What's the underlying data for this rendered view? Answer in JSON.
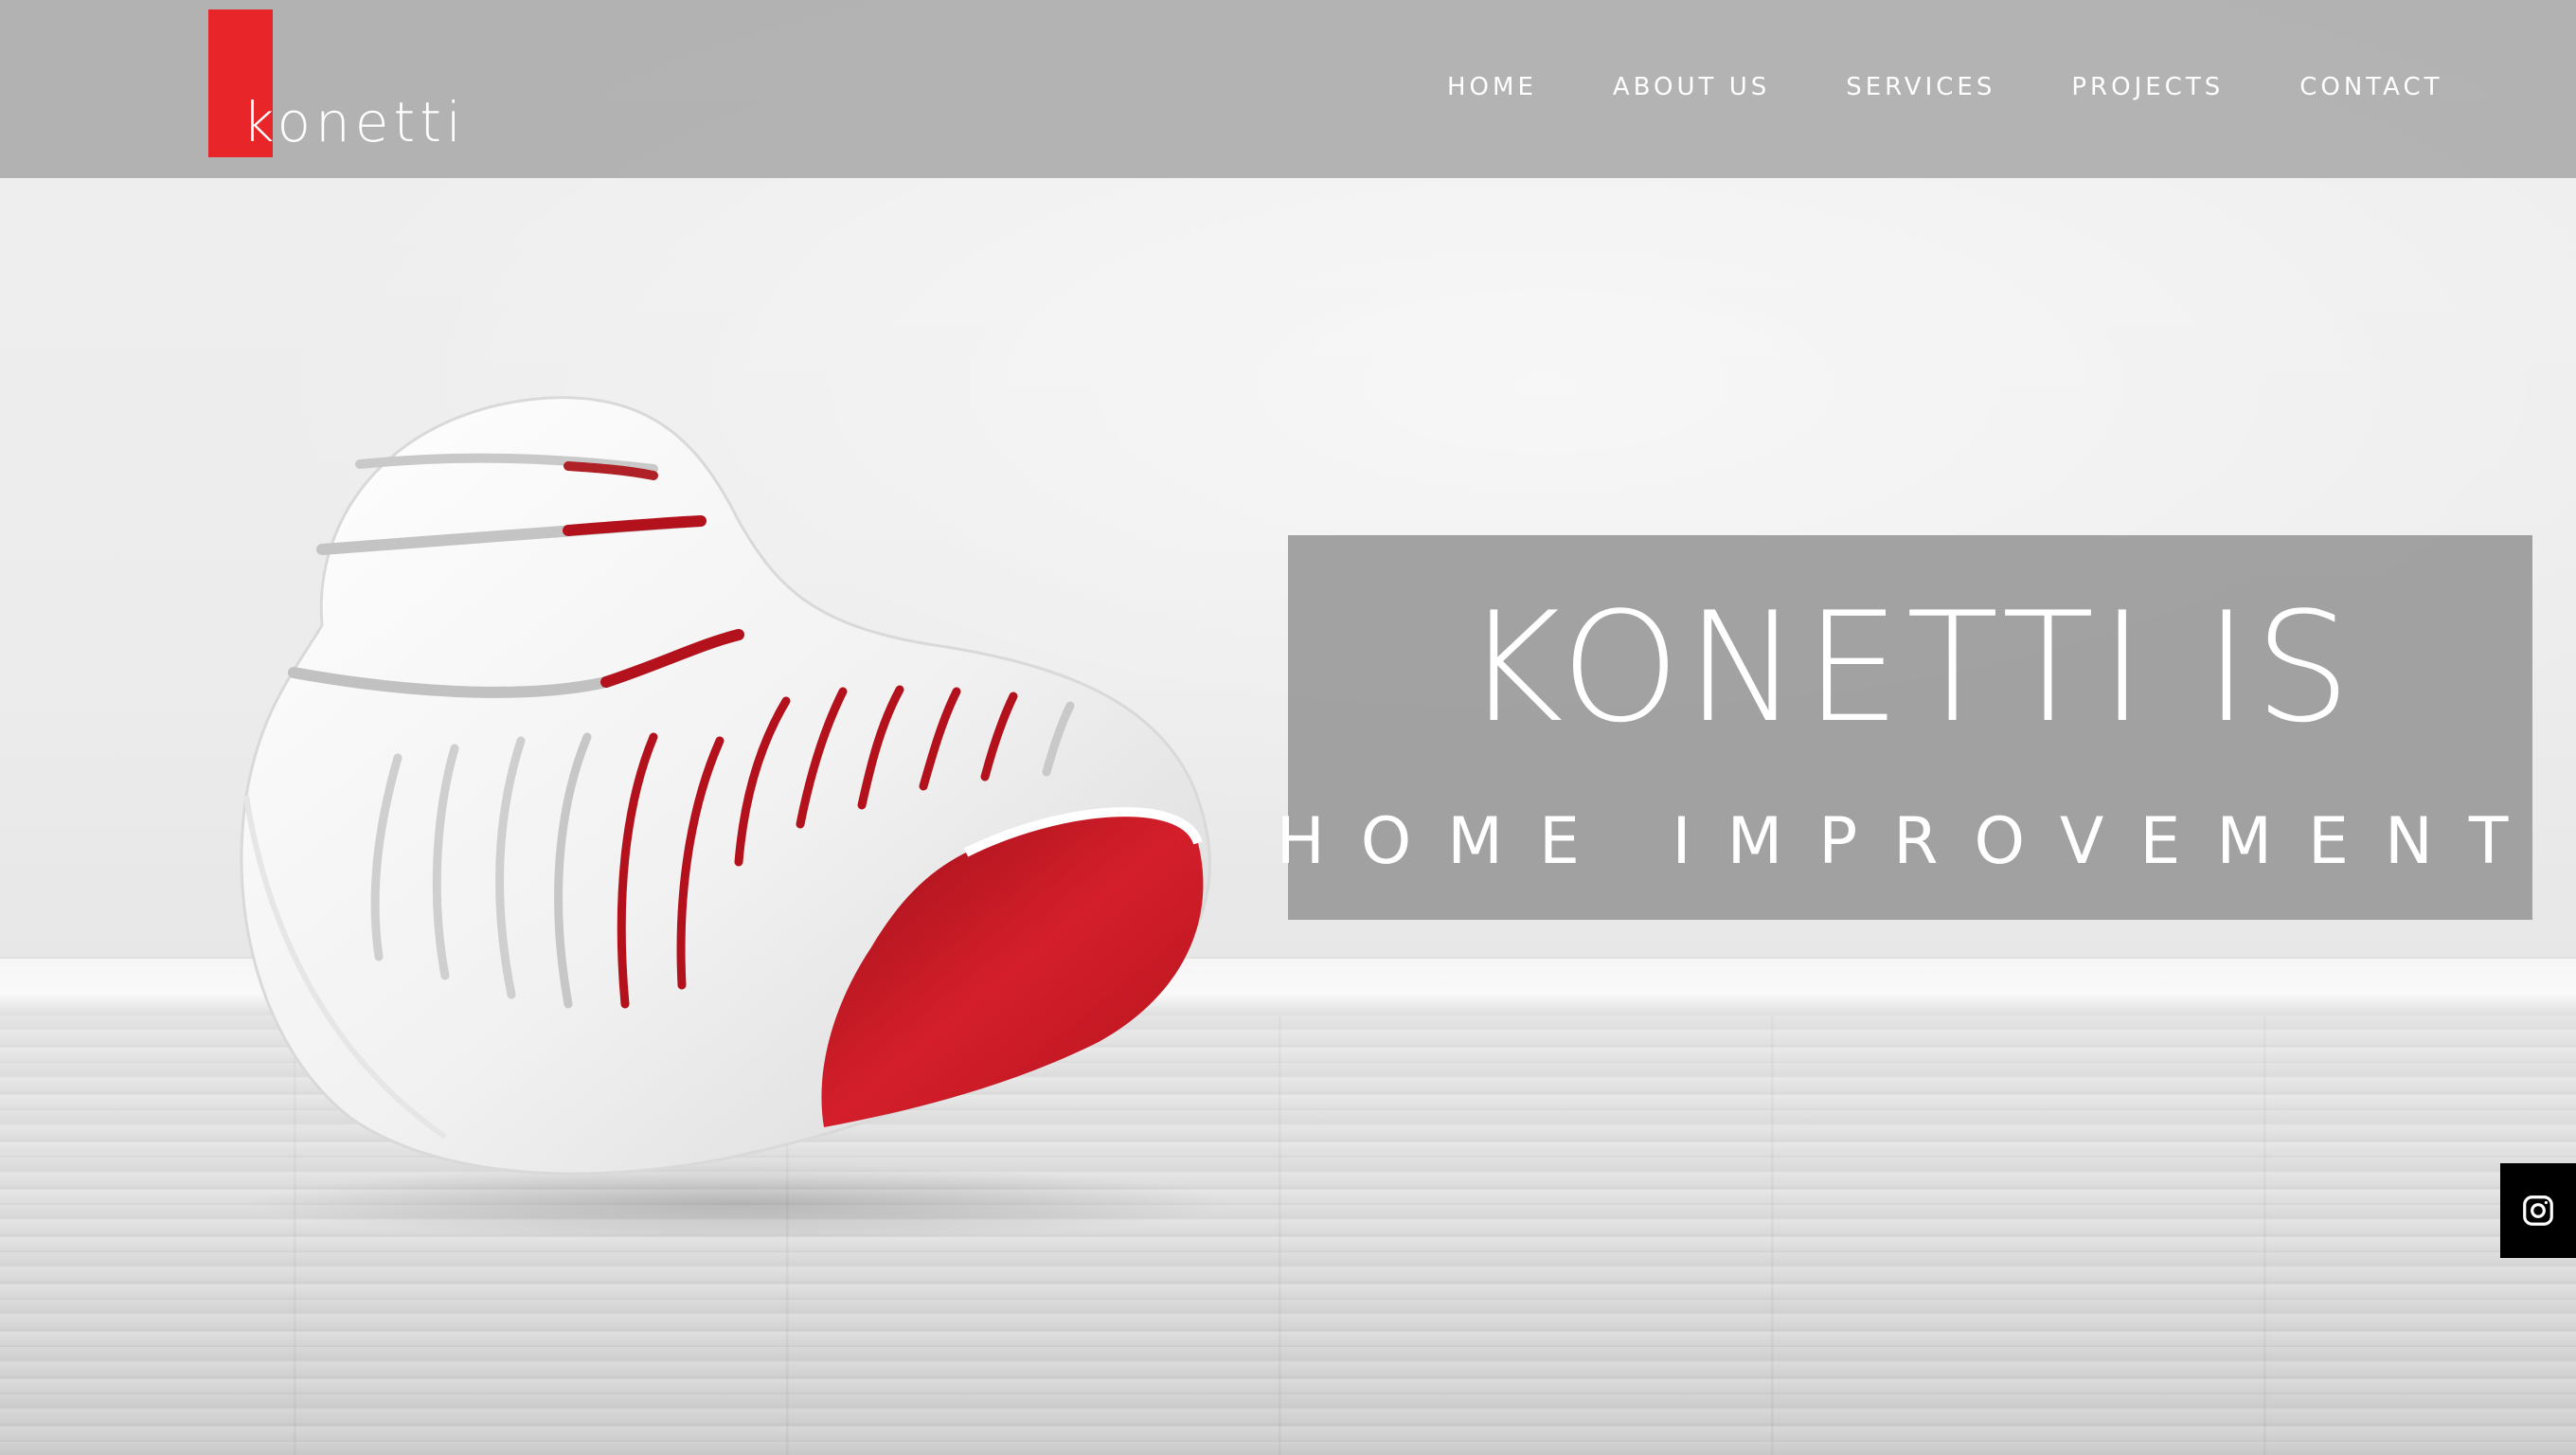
{
  "brand": {
    "logo_text": "konetti",
    "accent_color": "#e8262a"
  },
  "nav": {
    "items": [
      {
        "label": "HOME"
      },
      {
        "label": "ABOUT US"
      },
      {
        "label": "SERVICES"
      },
      {
        "label": "PROJECTS"
      },
      {
        "label": "CONTACT"
      }
    ]
  },
  "hero": {
    "title": "KONETTI IS",
    "subtitle": "HOME IMPROVEMENT"
  },
  "social": {
    "icon": "instagram-icon"
  }
}
